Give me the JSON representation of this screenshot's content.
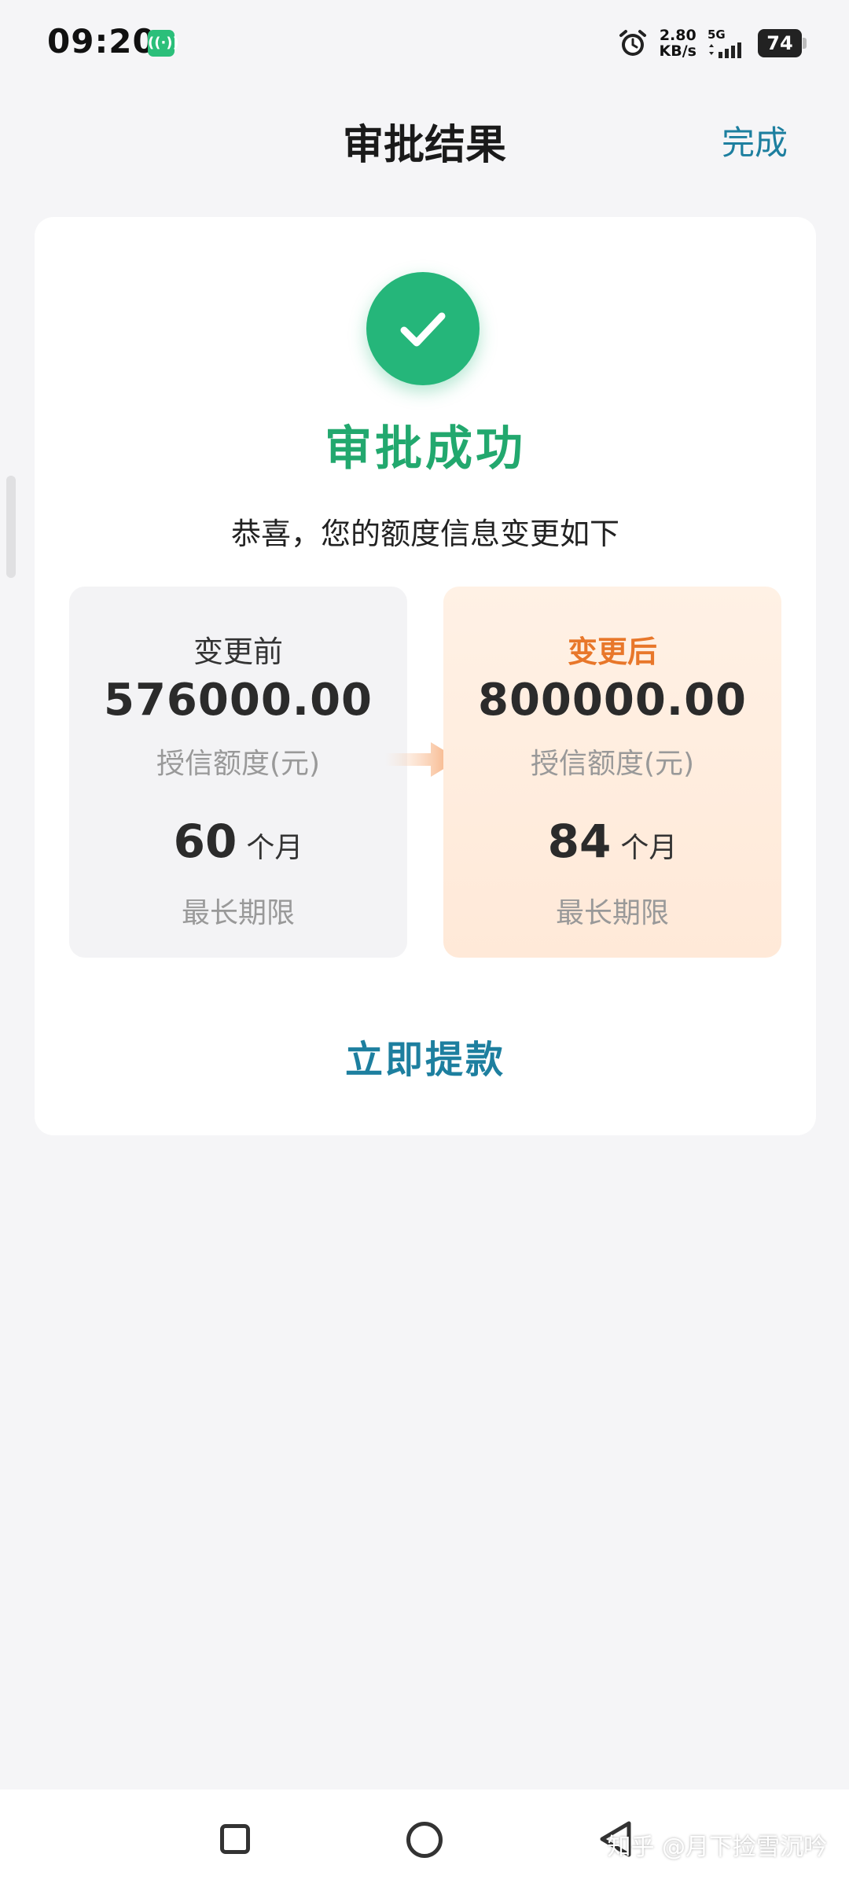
{
  "status_bar": {
    "time": "09:20",
    "speed_value": "2.80",
    "speed_unit": "KB/s",
    "network": "5G",
    "battery": "74",
    "icons": [
      "nfc-icon",
      "alarm-icon",
      "signal-icon",
      "battery-icon"
    ]
  },
  "header": {
    "title": "审批结果",
    "done_label": "完成"
  },
  "result": {
    "status_title": "审批成功",
    "subtitle": "恭喜，您的额度信息变更如下"
  },
  "before": {
    "label": "变更前",
    "amount": "576000.00",
    "amount_caption": "授信额度(元)",
    "term_value": "60",
    "term_unit": "个月",
    "term_caption": "最长期限"
  },
  "after": {
    "label": "变更后",
    "amount": "800000.00",
    "amount_caption": "授信额度(元)",
    "term_value": "84",
    "term_unit": "个月",
    "term_caption": "最长期限"
  },
  "action": {
    "withdraw_label": "立即提款"
  },
  "watermark": "知乎 @月下捡雪沉吟",
  "colors": {
    "success_green": "#25b67a",
    "accent_teal": "#1d7f9f",
    "after_orange": "#e8772a",
    "page_bg": "#f5f5f7"
  }
}
